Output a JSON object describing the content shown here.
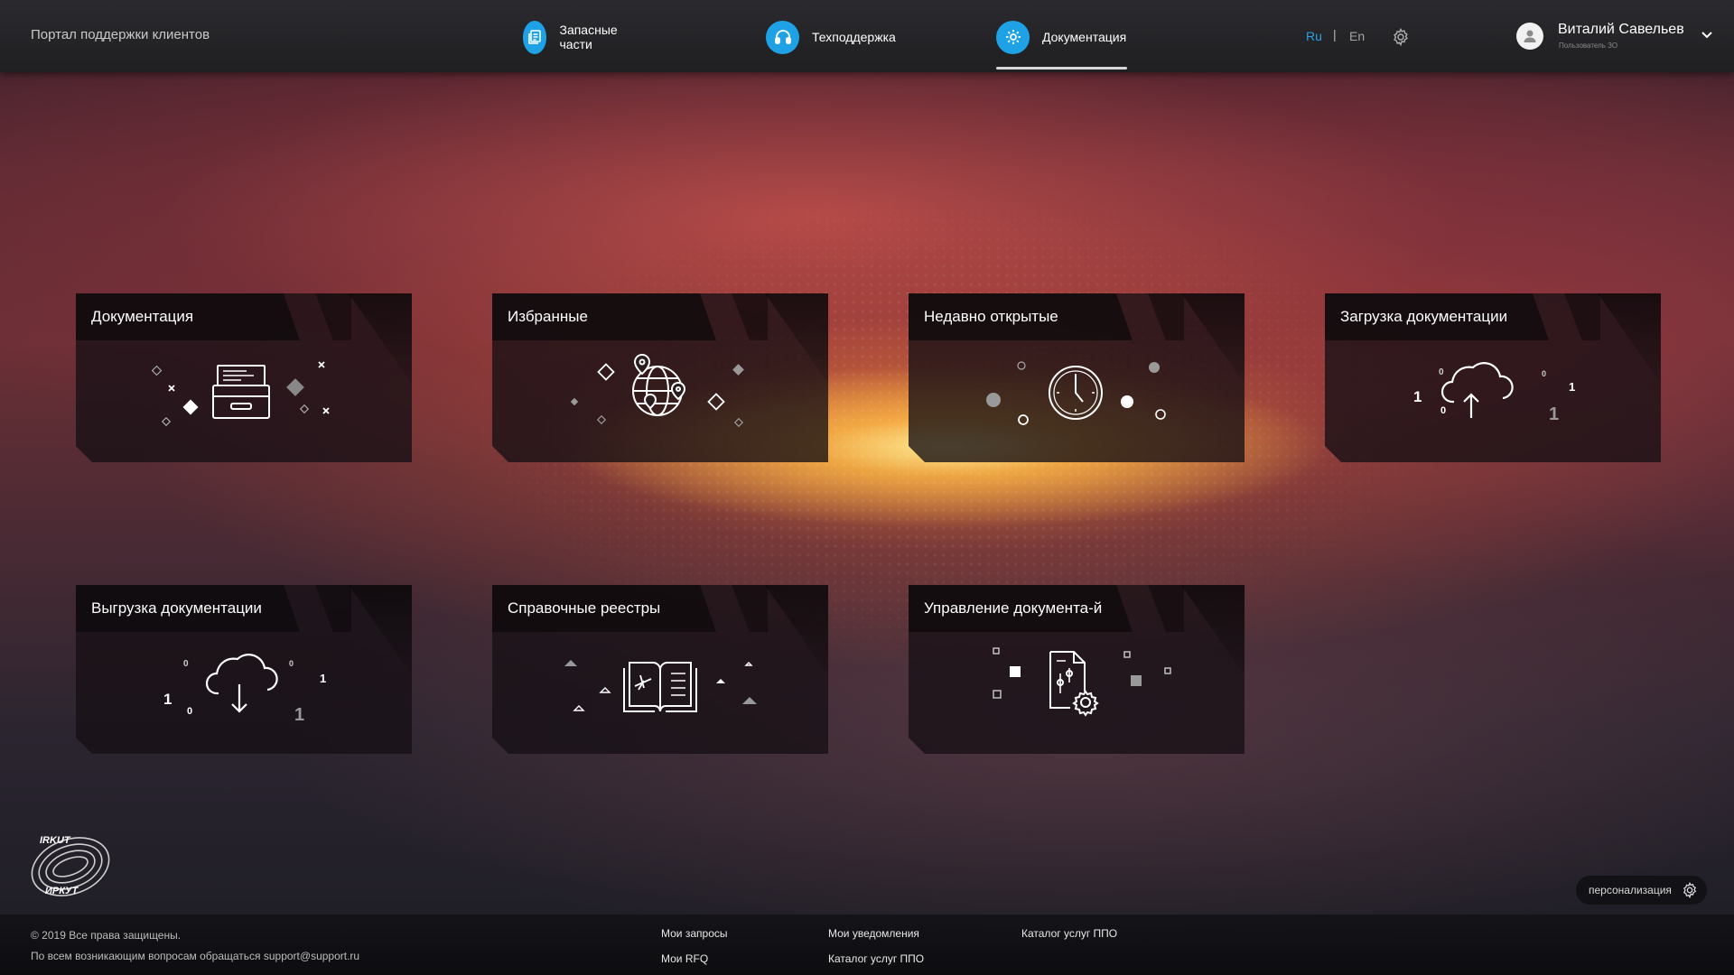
{
  "header": {
    "portal_title": "Портал поддержки клиентов",
    "nav": [
      {
        "label": "Запасные части",
        "icon": "parts-document-icon"
      },
      {
        "label": "Техподдержка",
        "icon": "headset-icon"
      },
      {
        "label": "Документация",
        "icon": "gear-document-icon",
        "active": true
      }
    ],
    "lang": {
      "ru": "Ru",
      "separator": "|",
      "en": "En",
      "active": "Ru"
    },
    "user": {
      "name": "Виталий Савельев",
      "role": "Пользователь ЗО"
    }
  },
  "tiles": [
    {
      "title": "Документация",
      "icon": "archive-drawer-icon"
    },
    {
      "title": "Избранные",
      "icon": "globe-pins-icon"
    },
    {
      "title": "Недавно открытые",
      "icon": "clock-icon"
    },
    {
      "title": "Загрузка документации",
      "icon": "cloud-upload-icon"
    },
    {
      "title": "Выгрузка документации",
      "icon": "cloud-download-icon"
    },
    {
      "title": "Справочные реестры",
      "icon": "book-plane-icon"
    },
    {
      "title": "Управление документа-й",
      "icon": "document-settings-icon"
    }
  ],
  "binary_digits": {
    "one": "1",
    "zero": "0"
  },
  "footer": {
    "copyright": "© 2019 Все права защищены.",
    "contact": "По всем возникающим вопросам обращаться support@support.ru",
    "links": [
      "Мои запросы",
      "Мои RFQ",
      "Мои уведомления",
      "Каталог услуг ППО",
      "Каталог услуг ППО"
    ]
  },
  "logo": {
    "top_text": "IRKUT",
    "bottom_text": "ИРКУТ"
  },
  "personalization": {
    "label": "персонализация"
  },
  "colors": {
    "accent": "#1fa1e6",
    "lang_active": "#2a9fe3"
  }
}
